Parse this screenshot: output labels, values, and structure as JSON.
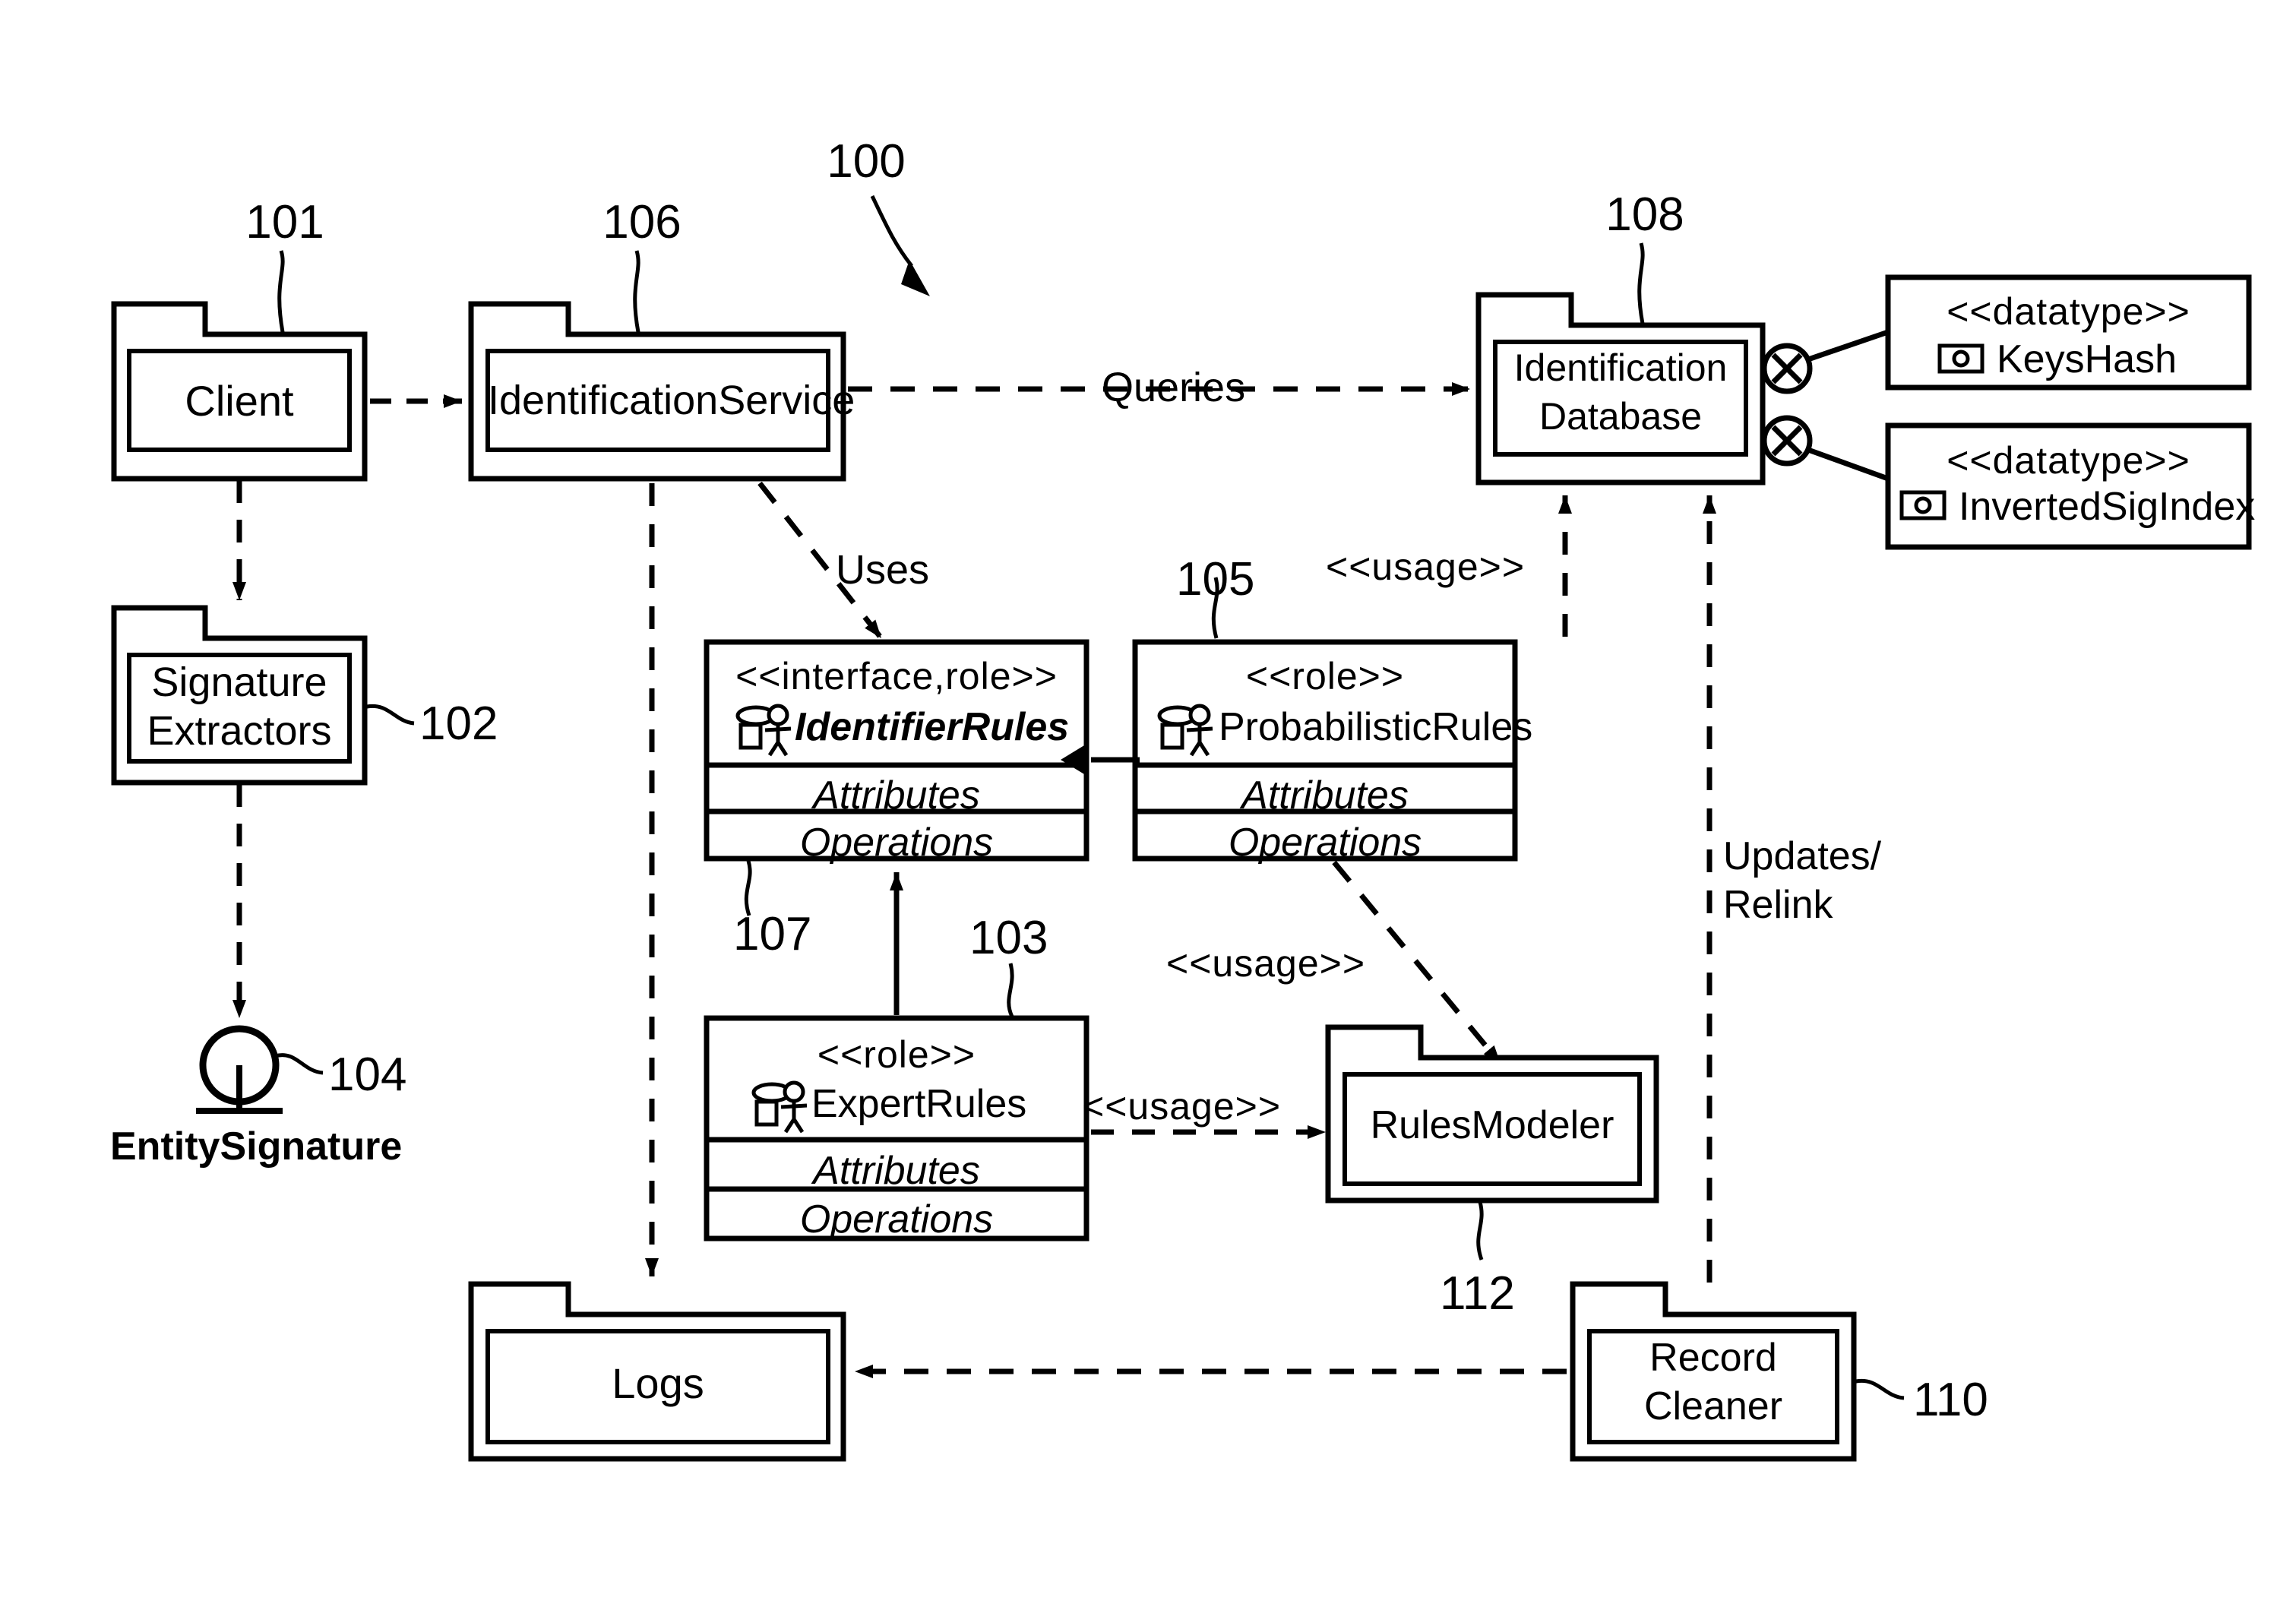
{
  "figure": {
    "reference_numerals": {
      "system": "100",
      "client": "101",
      "signature_extractors": "102",
      "expert_rules": "103",
      "entity_signature": "104",
      "probabilistic_rules": "105",
      "identification_service": "106",
      "identifier_rules": "107",
      "identification_database": "108",
      "record_cleaner": "110",
      "rules_modeler": "112"
    }
  },
  "packages": {
    "client": {
      "label": "Client"
    },
    "signature_extractors": {
      "label": "Signature\nExtractors",
      "line1": "Signature",
      "line2": "Extractors"
    },
    "identification_service": {
      "label": "IdentificationService"
    },
    "identification_database": {
      "label": "Identification\nDatabase",
      "line1": "Identification",
      "line2": "Database"
    },
    "logs": {
      "label": "Logs"
    },
    "rules_modeler": {
      "label": "RulesModeler"
    },
    "record_cleaner": {
      "label": "Record\nCleaner",
      "line1": "Record",
      "line2": "Cleaner"
    }
  },
  "interface_node": {
    "label": "EntitySignature"
  },
  "classes": {
    "identifier_rules": {
      "stereotype": "<<interface,role>>",
      "name": "IdentifierRules",
      "attributes": "Attributes",
      "operations": "Operations",
      "icon": "role-actor-icon",
      "name_italic": true
    },
    "probabilistic_rules": {
      "stereotype": "<<role>>",
      "name": "ProbabilisticRules",
      "attributes": "Attributes",
      "operations": "Operations",
      "icon": "role-actor-icon",
      "name_italic": false
    },
    "expert_rules": {
      "stereotype": "<<role>>",
      "name": "ExpertRules",
      "attributes": "Attributes",
      "operations": "Operations",
      "icon": "role-actor-icon",
      "name_italic": false
    }
  },
  "datatypes": {
    "keys_hash": {
      "stereotype": "<<datatype>>",
      "name": "KeysHash",
      "icon": "datatype-icon"
    },
    "inverted_sig_index": {
      "stereotype": "<<datatype>>",
      "name": "InvertedSigIndex",
      "icon": "datatype-icon"
    }
  },
  "edge_labels": {
    "queries": "Queries",
    "uses": "Uses",
    "usage_db": "<<usage>>",
    "usage_modeler": "<<usage>>",
    "usage_expert": "<<usage>>",
    "updates_relink_line1": "Updates/",
    "updates_relink_line2": "Relink"
  },
  "colors": {
    "stroke": "#000000",
    "background": "#ffffff"
  }
}
